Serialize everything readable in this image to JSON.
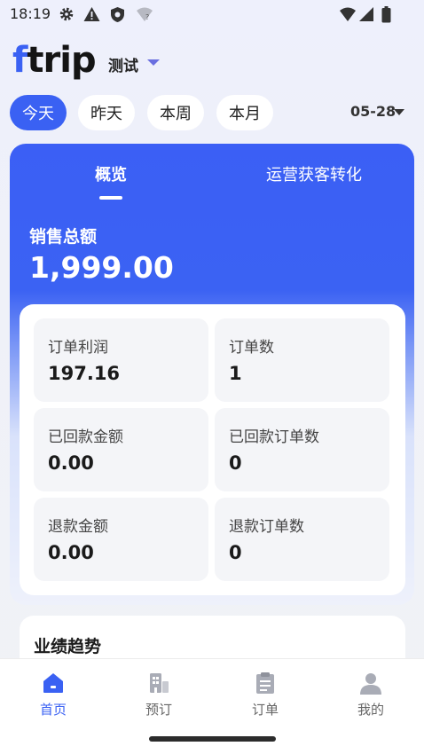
{
  "status_bar": {
    "time": "18:19",
    "icons": [
      "gear-icon",
      "warning-icon",
      "shield-icon",
      "wifi-question-icon",
      "wifi-icon",
      "signal-icon",
      "battery-icon"
    ]
  },
  "header": {
    "logo_first": "f",
    "logo_rest": "trip",
    "environment": "测试"
  },
  "date_filters": {
    "chips": [
      "今天",
      "昨天",
      "本周",
      "本月"
    ],
    "active_index": 0,
    "selected_date": "05-28"
  },
  "tabs": [
    "概览",
    "运营获客转化"
  ],
  "summary": {
    "label": "销售总额",
    "value": "1,999.00"
  },
  "metrics": [
    {
      "label": "订单利润",
      "value": "197.16"
    },
    {
      "label": "订单数",
      "value": "1"
    },
    {
      "label": "已回款金额",
      "value": "0.00"
    },
    {
      "label": "已回款订单数",
      "value": "0"
    },
    {
      "label": "退款金额",
      "value": "0.00"
    },
    {
      "label": "退款订单数",
      "value": "0"
    }
  ],
  "trend": {
    "title": "业绩趋势"
  },
  "bottom_nav": [
    {
      "label": "首页",
      "icon": "home-icon",
      "active": true
    },
    {
      "label": "预订",
      "icon": "building-icon",
      "active": false
    },
    {
      "label": "订单",
      "icon": "clipboard-icon",
      "active": false
    },
    {
      "label": "我的",
      "icon": "user-icon",
      "active": false
    }
  ],
  "colors": {
    "accent": "#3a61f3",
    "card_blue": "#3b5ff5"
  }
}
